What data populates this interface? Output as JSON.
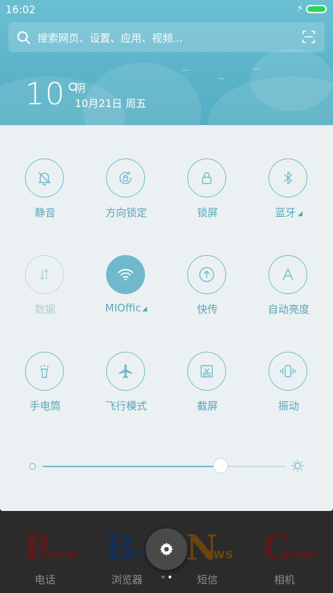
{
  "status_bar": {
    "time": "16:02"
  },
  "search": {
    "placeholder": "搜索网页、设置、应用、视频..."
  },
  "weather": {
    "temperature": "10°",
    "condition": "阴",
    "date": "10月21日 周五"
  },
  "quick_settings": {
    "tiles": [
      {
        "label": "静音",
        "icon": "bell-off-icon",
        "state": "off"
      },
      {
        "label": "方向锁定",
        "icon": "rotation-lock-icon",
        "state": "off"
      },
      {
        "label": "锁屏",
        "icon": "lock-icon",
        "state": "off"
      },
      {
        "label": "蓝牙",
        "icon": "bluetooth-icon",
        "state": "off",
        "has_menu": true
      },
      {
        "label": "数据",
        "icon": "data-arrows-icon",
        "state": "disabled"
      },
      {
        "label": "MIOffic",
        "icon": "wifi-icon",
        "state": "on",
        "has_menu": true
      },
      {
        "label": "快传",
        "icon": "transfer-icon",
        "state": "off"
      },
      {
        "label": "自动亮度",
        "icon": "auto-brightness-icon",
        "state": "off"
      },
      {
        "label": "手电筒",
        "icon": "flashlight-icon",
        "state": "off"
      },
      {
        "label": "飞行模式",
        "icon": "airplane-icon",
        "state": "off"
      },
      {
        "label": "截屏",
        "icon": "screenshot-icon",
        "state": "off"
      },
      {
        "label": "振动",
        "icon": "vibrate-icon",
        "state": "off"
      }
    ],
    "brightness_level": 0.73
  },
  "dock": {
    "apps": [
      {
        "label": "电话",
        "letter": "P",
        "word": "hone",
        "color": "#b0282a"
      },
      {
        "label": "浏览器",
        "letter": "B",
        "word": "row",
        "color": "#1e5aa8"
      },
      {
        "label": "短信",
        "letter": "N",
        "word": "ews",
        "color": "#e38a1c"
      },
      {
        "label": "相机",
        "letter": "C",
        "word": "amer",
        "color": "#b0282a"
      }
    ]
  },
  "colors": {
    "accent": "#6fb9cb",
    "panel_bg": "#ebf1f3",
    "header_bg": "#5bb3c9"
  }
}
